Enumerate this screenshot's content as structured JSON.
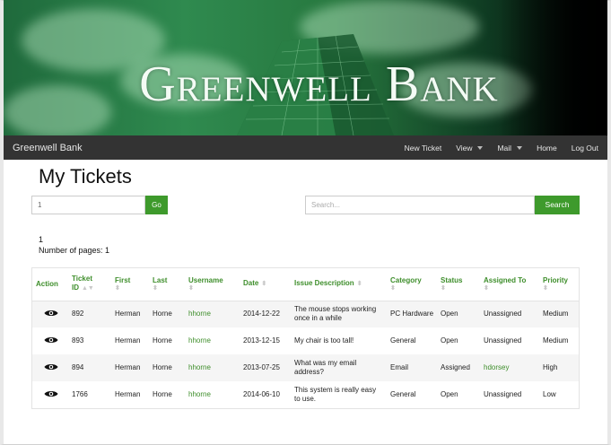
{
  "app": {
    "title": "Greenwell Bank"
  },
  "navbar": {
    "brand": "Greenwell Bank",
    "items": [
      {
        "label": "New Ticket",
        "dropdown": false
      },
      {
        "label": "View",
        "dropdown": true
      },
      {
        "label": "Mail",
        "dropdown": true
      },
      {
        "label": "Home",
        "dropdown": false
      },
      {
        "label": "Log Out",
        "dropdown": false
      }
    ]
  },
  "page": {
    "title": "My Tickets",
    "page_input_value": "1",
    "go_label": "Go",
    "search_placeholder": "Search...",
    "search_label": "Search",
    "current_page": "1",
    "pages_text": "Number of pages: 1"
  },
  "table": {
    "headers": {
      "action": "Action",
      "ticket_id_1": "Ticket",
      "ticket_id_2": "ID",
      "first": "First",
      "last": "Last",
      "username": "Username",
      "date": "Date",
      "issue": "Issue Description",
      "category": "Category",
      "status": "Status",
      "assigned": "Assigned To",
      "priority": "Priority"
    },
    "rows": [
      {
        "id": "892",
        "first": "Herman",
        "last": "Horne",
        "username": "hhorne",
        "date": "2014-12-22",
        "issue": "The mouse stops working once in a while",
        "category": "PC Hardware",
        "status": "Open",
        "assigned": "Unassigned",
        "priority": "Medium"
      },
      {
        "id": "893",
        "first": "Herman",
        "last": "Horne",
        "username": "hhorne",
        "date": "2013-12-15",
        "issue": "My chair is too tall!",
        "category": "General",
        "status": "Open",
        "assigned": "Unassigned",
        "priority": "Medium"
      },
      {
        "id": "894",
        "first": "Herman",
        "last": "Horne",
        "username": "hhorne",
        "date": "2013-07-25",
        "issue": "What was my email address?",
        "category": "Email",
        "status": "Assigned",
        "assigned": "hdorsey",
        "priority": "High"
      },
      {
        "id": "1766",
        "first": "Herman",
        "last": "Horne",
        "username": "hhorne",
        "date": "2014-06-10",
        "issue": "This system is really easy to use.",
        "category": "General",
        "status": "Open",
        "assigned": "Unassigned",
        "priority": "Low"
      }
    ]
  },
  "icons": {
    "view": "eye-icon",
    "sort": "sort-icon",
    "dropdown": "caret-down-icon"
  },
  "colors": {
    "accent": "#3e9a2c",
    "navbar": "#333333",
    "link": "#3e8e2b"
  }
}
